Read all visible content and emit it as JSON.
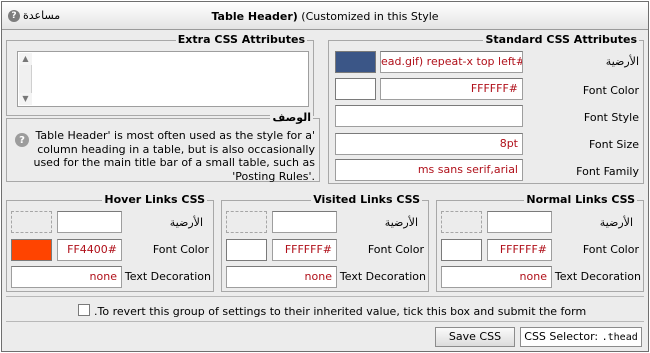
{
  "titlebar": {
    "help_label": "مساعدة",
    "help_icon": "question-icon",
    "title_bold": "Table Header)",
    "title_rest": " (Customized in this Style"
  },
  "extra_css": {
    "legend": "Extra CSS Attributes",
    "value": ""
  },
  "description": {
    "legend": "الوصف",
    "icon": "question-icon",
    "text": "Table Header' is most often used as the style for a' column heading in a table, but is also occasionally used for the main title bar of a small table, such as 'Posting Rules'."
  },
  "standard_css": {
    "legend": "Standard CSS Attributes",
    "background_label": "الأرضية",
    "background_value": "ead.gif) repeat-x top left#",
    "background_swatch": "#3b5687",
    "font_color_label": "Font Color",
    "font_color_value": "FFFFFF#",
    "font_style_label": "Font Style",
    "font_style_value": "",
    "font_size_label": "Font Size",
    "font_size_value": "8pt",
    "font_family_label": "Font Family",
    "font_family_value": "ms sans serif,arial"
  },
  "hover_links": {
    "legend": "Hover Links CSS",
    "background_label": "الأرضية",
    "background_value": "",
    "font_color_label": "Font Color",
    "font_color_value": "FF4400#",
    "font_color_swatch": "#ff4400",
    "text_decoration_label": "Text Decoration",
    "text_decoration_value": "none"
  },
  "visited_links": {
    "legend": "Visited Links CSS",
    "background_label": "الأرضية",
    "background_value": "",
    "font_color_label": "Font Color",
    "font_color_value": "FFFFFF#",
    "font_color_swatch": "#ffffff",
    "text_decoration_label": "Text Decoration",
    "text_decoration_value": "none"
  },
  "normal_links": {
    "legend": "Normal Links CSS",
    "background_label": "الأرضية",
    "background_value": "",
    "font_color_label": "Font Color",
    "font_color_value": "FFFFFF#",
    "font_color_swatch": "#ffffff",
    "text_decoration_label": "Text Decoration",
    "text_decoration_value": "none"
  },
  "footer": {
    "revert_text": ".To revert this group of settings to their inherited value, tick this box and submit the form",
    "revert_checked": false,
    "save_button": "Save CSS",
    "selector_label": "CSS Selector:",
    "selector_value": ".thead"
  }
}
